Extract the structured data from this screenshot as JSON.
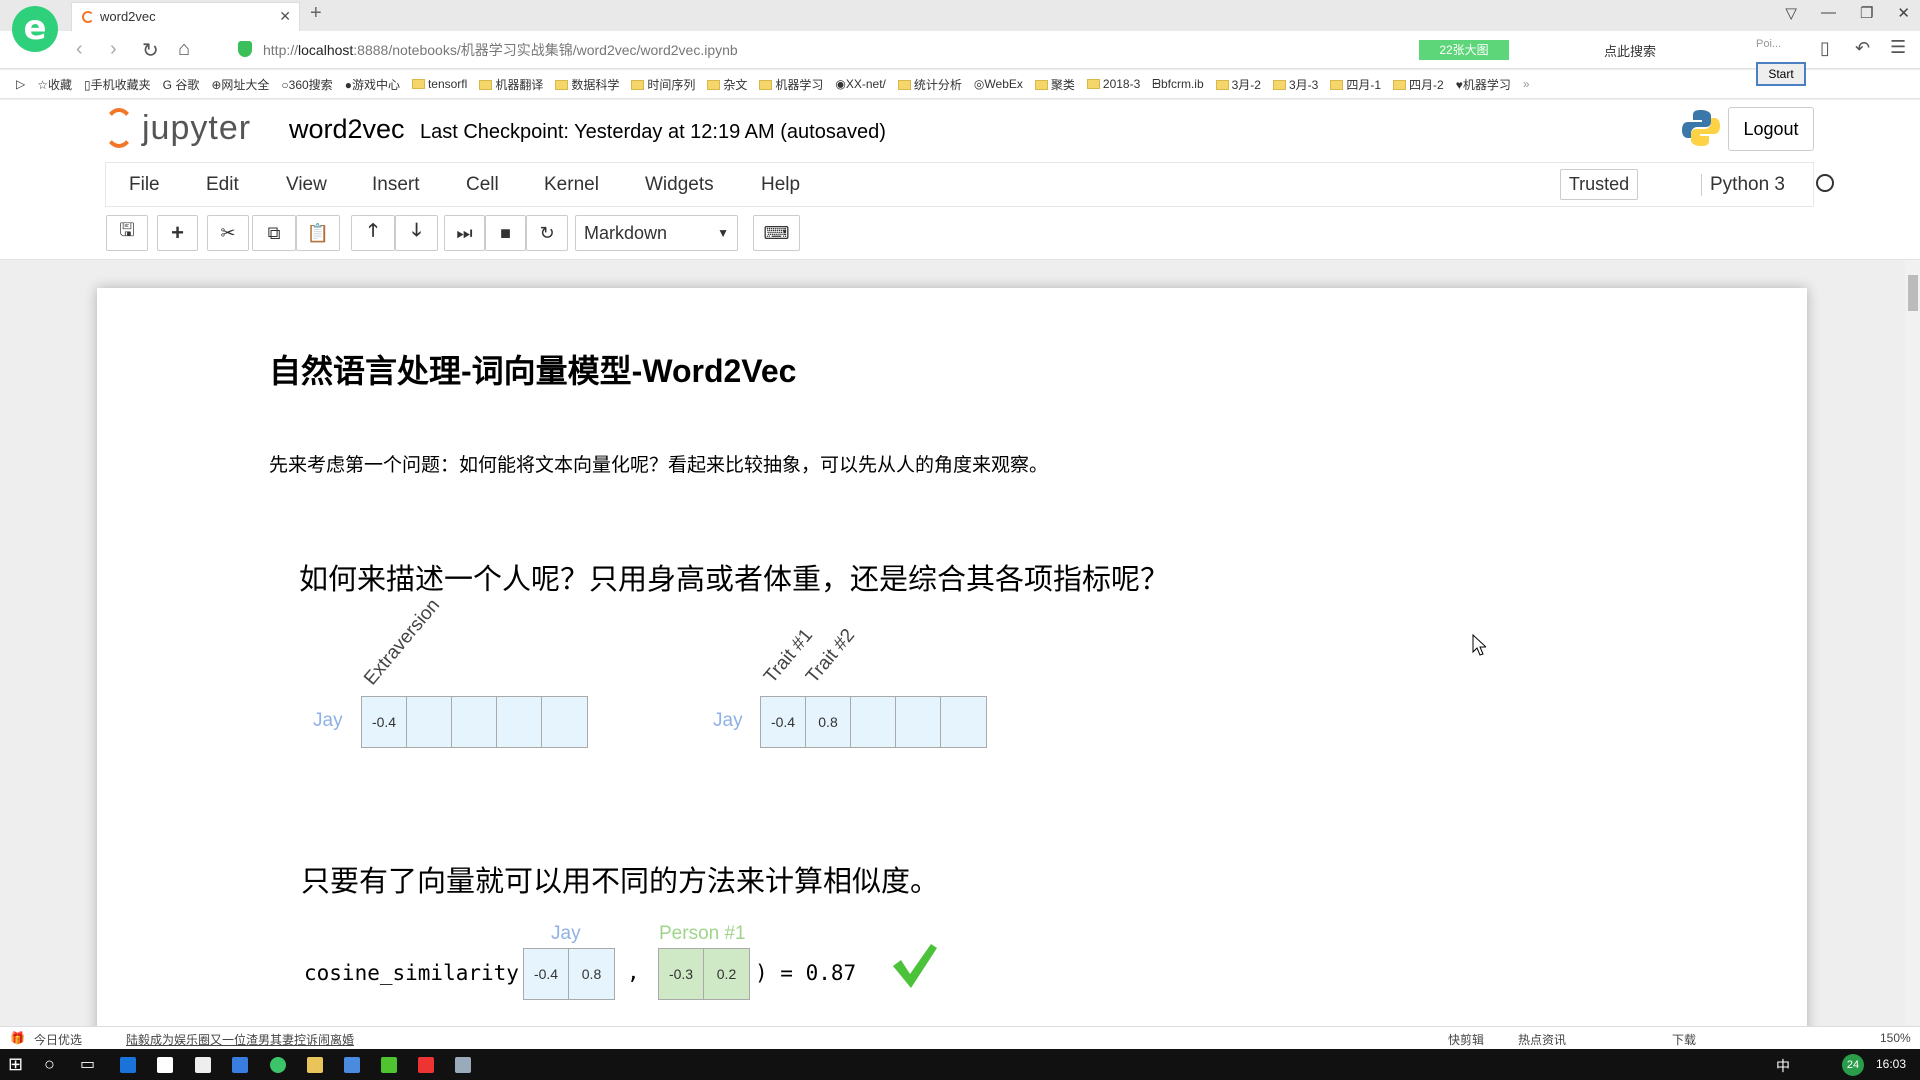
{
  "browser": {
    "tab_title": "word2vec",
    "url_prefix": "http://",
    "url_host": "localhost",
    "url_rest": ":8888/notebooks/机器学习实战集锦/word2vec/word2vec.ipynb",
    "pics_badge": "22张大图",
    "search_hint": "点此搜索",
    "poi": "Poi...",
    "start": "Start",
    "bookmarks": [
      "收藏",
      "手机收藏夹",
      "谷歌",
      "网址大全",
      "360搜索",
      "游戏中心",
      "tensorfl",
      "机器翻译",
      "数据科学",
      "时间序列",
      "杂文",
      "机器学习",
      "XX-net/",
      "统计分析",
      "WebEx",
      "聚类",
      "2018-3",
      "bfcrm.ib",
      "3月-2",
      "3月-3",
      "四月-1",
      "四月-2",
      "机器学习"
    ]
  },
  "jupyter": {
    "logo_text": "jupyter",
    "notebook_name": "word2vec",
    "checkpoint": "Last Checkpoint: Yesterday at 12:19 AM (autosaved)",
    "logout": "Logout",
    "menu": [
      "File",
      "Edit",
      "View",
      "Insert",
      "Cell",
      "Kernel",
      "Widgets",
      "Help"
    ],
    "trusted": "Trusted",
    "kernel": "Python 3",
    "cell_type": "Markdown"
  },
  "cell": {
    "title": "自然语言处理-词向量模型-Word2Vec",
    "intro": "先来考虑第一个问题：如何能将文本向量化呢？看起来比较抽象，可以先从人的角度来观察。",
    "heading1": "如何来描述一个人呢？只用身高或者体重，还是综合其各项指标呢？",
    "heading2": "只要有了向量就可以用不同的方法来计算相似度。",
    "fig1": {
      "row_label": "Jay",
      "feature": "Extraversion",
      "values": [
        "-0.4",
        "",
        "",
        "",
        ""
      ]
    },
    "fig2": {
      "row_label": "Jay",
      "feature1": "Trait #1",
      "feature2": "Trait #2",
      "values": [
        "-0.4",
        "0.8",
        "",
        "",
        ""
      ]
    },
    "cos": {
      "func": "cosine_similarity(",
      "label_a": "Jay",
      "a": [
        "-0.4",
        "0.8"
      ],
      "comma": ",",
      "label_b": "Person #1",
      "b": [
        "-0.3",
        "0.2"
      ],
      "result": ") = 0.87"
    }
  },
  "statusbar": {
    "left1": "今日优选",
    "news": "陆毅成为娱乐圈又一位渣男其妻控诉闹离婚",
    "items": [
      "快剪辑",
      "热点资讯",
      "下载",
      "150%"
    ]
  },
  "taskbar": {
    "notif": "24",
    "time": "16:03",
    "ime": "中"
  }
}
